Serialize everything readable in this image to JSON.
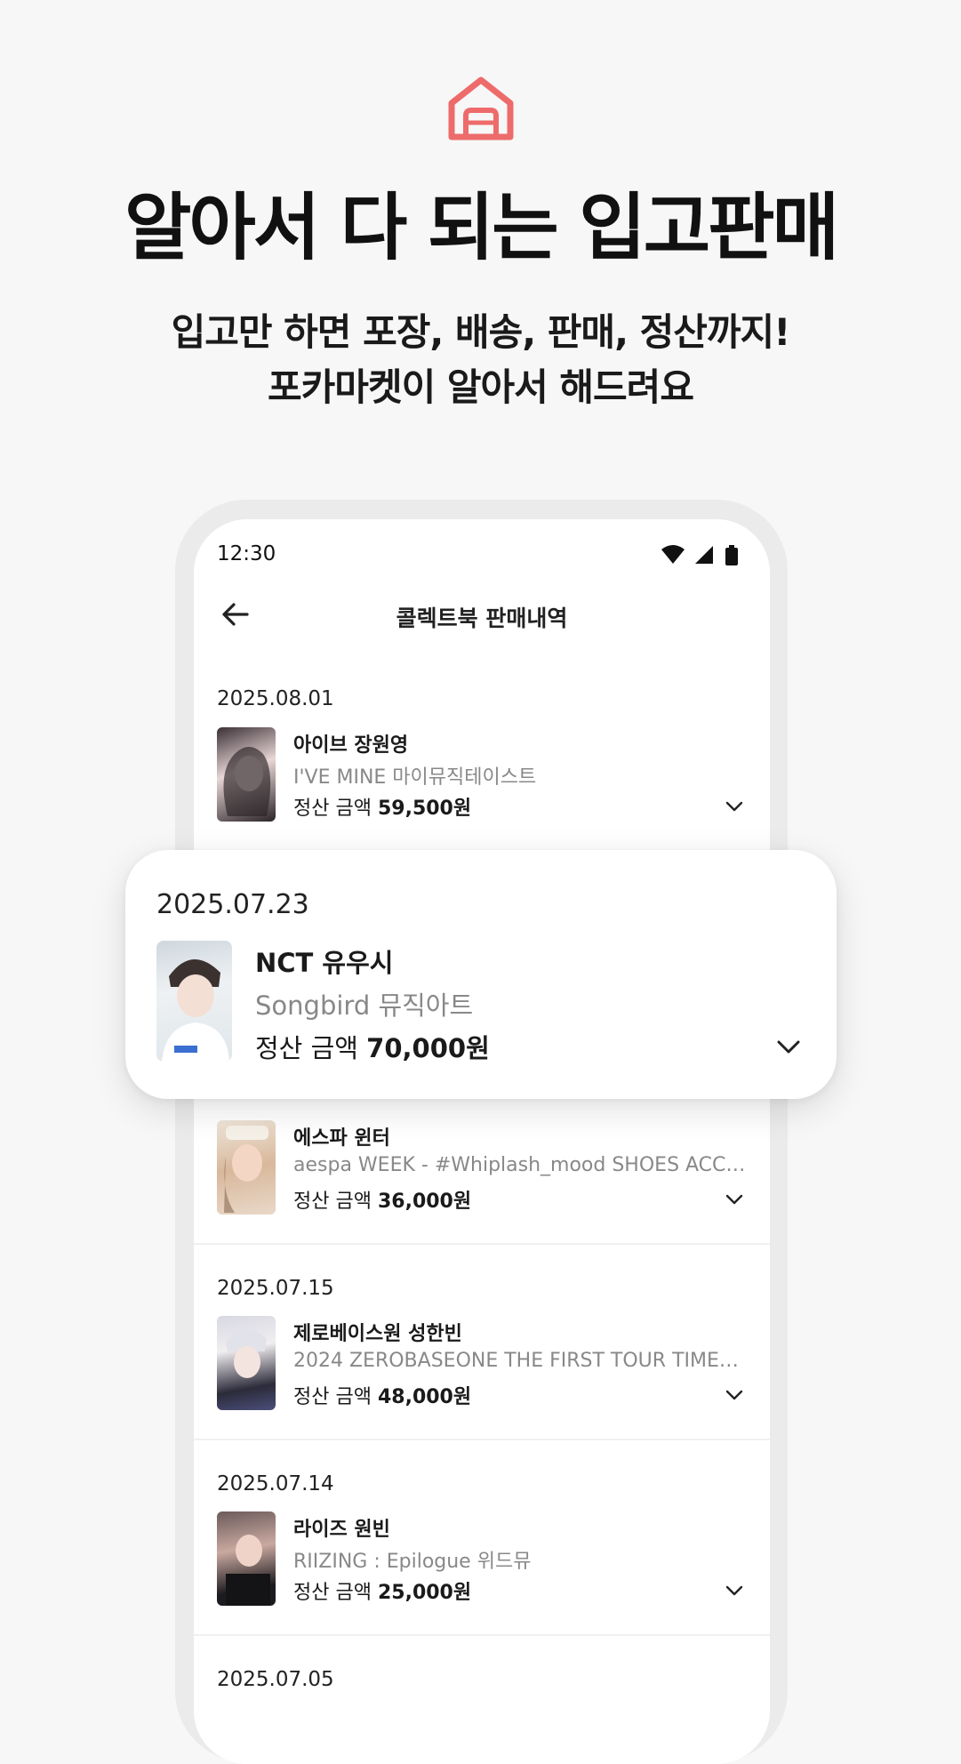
{
  "headline": "알아서 다 되는 입고판매",
  "subheadline": {
    "line1": "입고만 하면 포장, 배송, 판매, 정산까지!",
    "line2": "포카마켓이 알아서 해드려요"
  },
  "colors": {
    "accent": "#ee6b6b"
  },
  "phone": {
    "status_time": "12:30",
    "title": "콜렉트북 판매내역",
    "amount_label": "정산 금액",
    "entries": [
      {
        "date": "2025.08.01",
        "name": "아이브 장원영",
        "desc": "I'VE MINE 마이뮤직테이스트",
        "amount": "59,500원"
      },
      {
        "date": "",
        "name": "에스파 윈터",
        "desc": "aespa WEEK - #Whiplash_mood SHOES ACC S...",
        "amount": "36,000원"
      },
      {
        "date": "2025.07.15",
        "name": "제로베이스원 성한빈",
        "desc": "2024 ZEROBASEONE THE FIRST TOUR TIMELE...",
        "amount": "48,000원"
      },
      {
        "date": "2025.07.14",
        "name": "라이즈 원빈",
        "desc": "RIIZING : Epilogue 위드뮤",
        "amount": "25,000원"
      },
      {
        "date": "2025.07.05",
        "name": "",
        "desc": "",
        "amount": ""
      }
    ]
  },
  "highlight": {
    "date": "2025.07.23",
    "name": "NCT 유우시",
    "desc": "Songbird 뮤직아트",
    "amount_label": "정산 금액",
    "amount": "70,000원"
  }
}
